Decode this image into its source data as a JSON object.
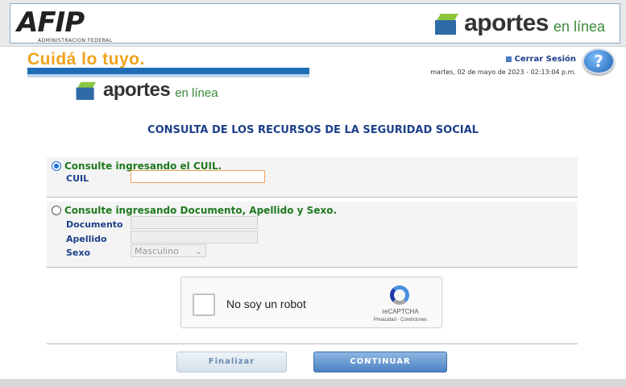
{
  "header": {
    "afip_logo_text": "AFIP",
    "afip_subtitle": "ADMINISTRACION FEDERAL",
    "aportes_word": "aportes",
    "aportes_suffix": "en línea"
  },
  "banner": {
    "slogan": "Cuidá lo tuyo.",
    "aportes_word": "aportes",
    "aportes_suffix": "en línea"
  },
  "session": {
    "logout_label": "Cerrar Sesión",
    "datetime": "martes, 02 de mayo de 2023 - 02:13:04 p.m.",
    "help_label": "?"
  },
  "page_title": "CONSULTA DE LOS RECURSOS DE LA SEGURIDAD SOCIAL",
  "option_cuil": {
    "label": "Consulte ingresando el CUIL.",
    "selected": true,
    "field_label": "CUIL",
    "value": ""
  },
  "option_doc": {
    "label": "Consulte ingresando Documento, Apellido y Sexo.",
    "selected": false,
    "documento_label": "Documento",
    "documento_value": "",
    "apellido_label": "Apellido",
    "apellido_value": "",
    "sexo_label": "Sexo",
    "sexo_value": "Masculino"
  },
  "captcha": {
    "label": "No soy un robot",
    "brand": "reCAPTCHA",
    "links": "Privacidad - Condiciones"
  },
  "buttons": {
    "finalizar": "Finalizar",
    "continuar": "CONTINUAR"
  },
  "colors": {
    "title_blue": "#1d3f8a",
    "option_green": "#1f7a1f",
    "slogan_orange": "#f0a21c",
    "continue_blue": "#4a82c3"
  }
}
